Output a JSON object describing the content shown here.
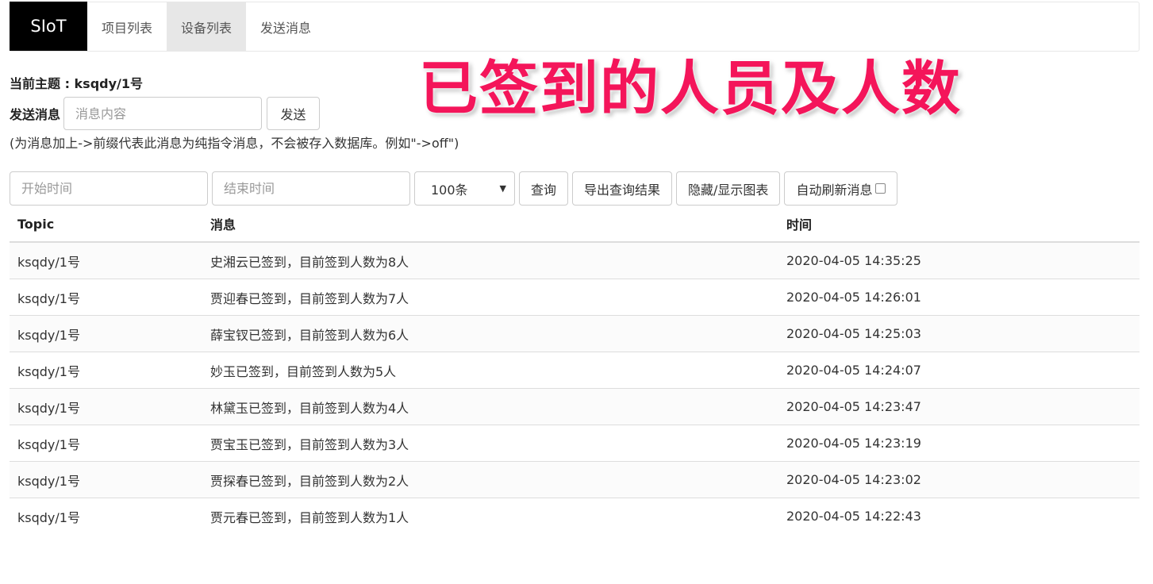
{
  "nav": {
    "brand": "SIoT",
    "items": [
      {
        "label": "项目列表"
      },
      {
        "label": "设备列表"
      },
      {
        "label": "发送消息"
      }
    ],
    "active_index": 1
  },
  "overlay_title": "已签到的人员及人数",
  "topic": {
    "label": "当前主题 : ksqdy/1号"
  },
  "send": {
    "label": "发送消息",
    "placeholder": "消息内容",
    "button": "发送"
  },
  "hint": "(为消息加上->前缀代表此消息为纯指令消息，不会被存入数据库。例如\"->off\")",
  "filters": {
    "start_placeholder": "开始时间",
    "end_placeholder": "结束时间",
    "limit_selected": "100条",
    "query_button": "查询",
    "export_button": "导出查询结果",
    "toggle_chart_button": "隐藏/显示图表",
    "auto_refresh_label": "自动刷新消息",
    "auto_refresh_checked": false
  },
  "table": {
    "headers": [
      "Topic",
      "消息",
      "时间"
    ],
    "rows": [
      [
        "ksqdy/1号",
        "史湘云已签到，目前签到人数为8人",
        "2020-04-05 14:35:25"
      ],
      [
        "ksqdy/1号",
        "贾迎春已签到，目前签到人数为7人",
        "2020-04-05 14:26:01"
      ],
      [
        "ksqdy/1号",
        "薛宝钗已签到，目前签到人数为6人",
        "2020-04-05 14:25:03"
      ],
      [
        "ksqdy/1号",
        "妙玉已签到，目前签到人数为5人",
        "2020-04-05 14:24:07"
      ],
      [
        "ksqdy/1号",
        "林黛玉已签到，目前签到人数为4人",
        "2020-04-05 14:23:47"
      ],
      [
        "ksqdy/1号",
        "贾宝玉已签到，目前签到人数为3人",
        "2020-04-05 14:23:19"
      ],
      [
        "ksqdy/1号",
        "贾探春已签到，目前签到人数为2人",
        "2020-04-05 14:23:02"
      ],
      [
        "ksqdy/1号",
        "贾元春已签到，目前签到人数为1人",
        "2020-04-05 14:22:43"
      ]
    ]
  }
}
